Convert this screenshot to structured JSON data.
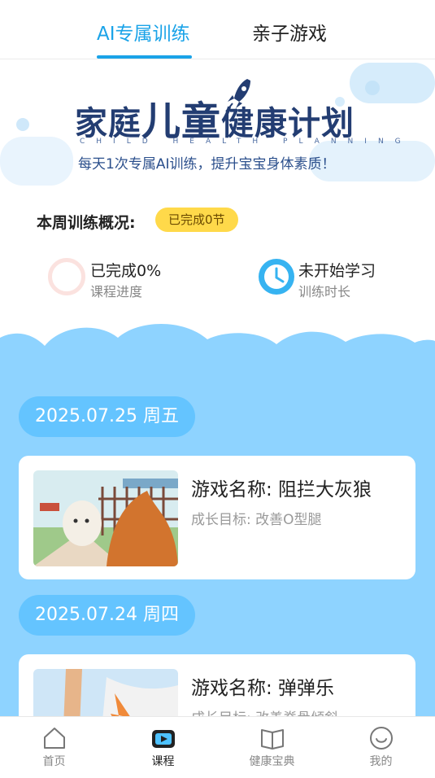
{
  "tabs": [
    {
      "label": "AI专属训练",
      "active": true
    },
    {
      "label": "亲子游戏",
      "active": false
    }
  ],
  "banner": {
    "title_a": "家庭",
    "title_b": "儿童",
    "title_c": "健康",
    "title_d": "计划",
    "subtitle_en": "CHILD HEALTH PLANNING",
    "subtitle": "每天1次专属AI训练，提升宝宝身体素质！"
  },
  "summary": {
    "title": "本周训练概况:",
    "badge": "已完成0节",
    "progress": {
      "value": "已完成0%",
      "label": "课程进度"
    },
    "duration": {
      "value": "未开始学习",
      "label": "训练时长"
    }
  },
  "sessions": [
    {
      "date": "2025.07.25 周五",
      "game_name": "游戏名称: 阻拦大灰狼",
      "goal": "成长目标: 改善O型腿"
    },
    {
      "date": "2025.07.24 周四",
      "game_name": "游戏名称: 弹弹乐",
      "goal": "成长目标: 改善脊骨倾斜"
    }
  ],
  "nav": [
    {
      "label": "首页",
      "icon": "home-icon",
      "active": false
    },
    {
      "label": "课程",
      "icon": "video-play-icon",
      "active": true
    },
    {
      "label": "健康宝典",
      "icon": "book-icon",
      "active": false
    },
    {
      "label": "我的",
      "icon": "smile-face-icon",
      "active": false
    }
  ],
  "colors": {
    "accent": "#1aa3e8",
    "sky": "#8ed3ff",
    "pill": "#64c4ff",
    "badge": "#ffd94a"
  }
}
